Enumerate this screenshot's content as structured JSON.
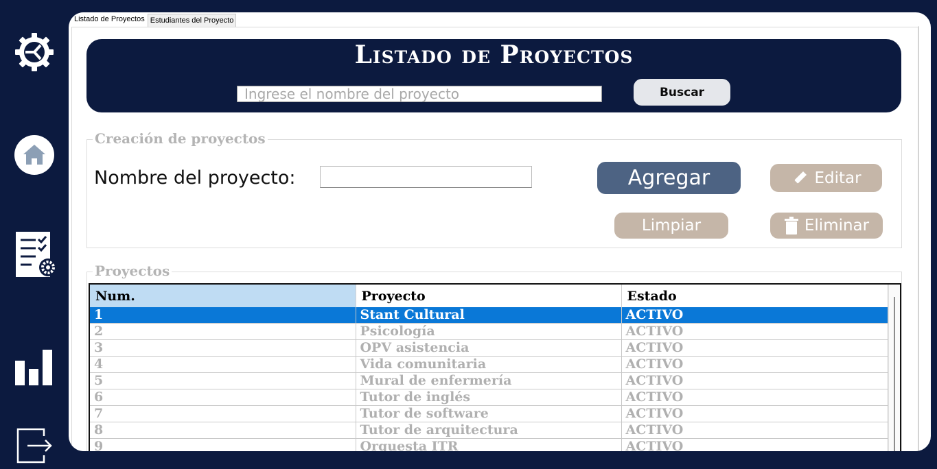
{
  "sidebar": {
    "icons": [
      "gear-icon",
      "home-icon",
      "tasks-settings-icon",
      "bar-chart-icon",
      "logout-icon"
    ]
  },
  "tabs": [
    {
      "label": "Listado de Proyectos",
      "active": true
    },
    {
      "label": "Estudiantes del Proyecto",
      "active": false
    }
  ],
  "header": {
    "title": "Listado de Proyectos",
    "search_placeholder": "Ingrese el nombre del proyecto",
    "search_button": "Buscar"
  },
  "create": {
    "legend": "Creación de proyectos",
    "name_label": "Nombre del proyecto:",
    "name_value": "",
    "add_button": "Agregar",
    "edit_button": "Editar",
    "clear_button": "Limpiar",
    "delete_button": "Eliminar"
  },
  "projects": {
    "legend": "Proyectos",
    "columns": [
      "Num.",
      "Proyecto",
      "Estado"
    ],
    "rows": [
      [
        "1",
        "Stant Cultural",
        "ACTIVO"
      ],
      [
        "2",
        "Psicología",
        "ACTIVO"
      ],
      [
        "3",
        "OPV asistencia",
        "ACTIVO"
      ],
      [
        "4",
        "Vida comunitaria",
        "ACTIVO"
      ],
      [
        "5",
        "Mural de enfermería",
        "ACTIVO"
      ],
      [
        "6",
        "Tutor de inglés",
        "ACTIVO"
      ],
      [
        "7",
        "Tutor de software",
        "ACTIVO"
      ],
      [
        "8",
        "Tutor de arquitectura",
        "ACTIVO"
      ],
      [
        "9",
        "Orquesta ITR",
        "ACTIVO"
      ]
    ],
    "selected_row": 0
  },
  "colors": {
    "navy": "#0c1a3f",
    "add_button": "#4d6383",
    "secondary_button": "#c5b6a8",
    "selection": "#0a78d7",
    "sorted_header": "#bfdcf3"
  }
}
